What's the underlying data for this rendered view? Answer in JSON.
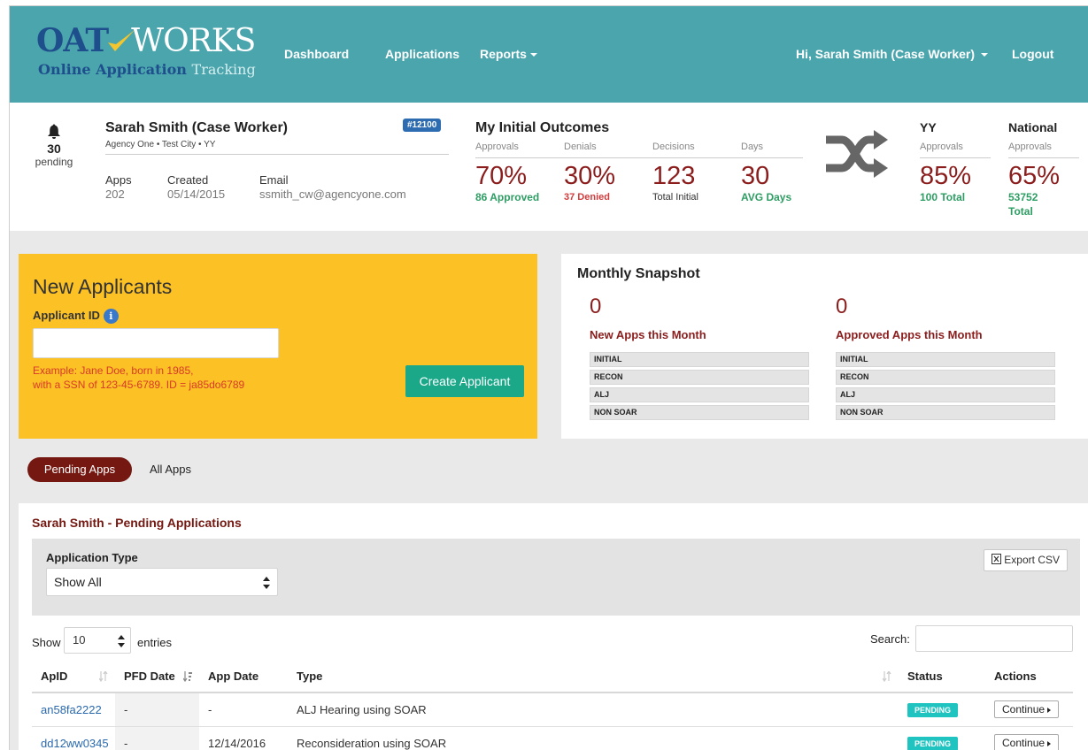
{
  "logo": {
    "oat": "OAT",
    "works": "WORKS",
    "tag_bold": "Online Application",
    "tag_light": "Tracking"
  },
  "nav": {
    "dashboard": "Dashboard",
    "applications": "Applications",
    "reports": "Reports",
    "user": "Hi, Sarah Smith (Case Worker)",
    "logout": "Logout"
  },
  "profile": {
    "pending_count": "30",
    "pending_label": "pending",
    "name": "Sarah Smith (Case Worker)",
    "agency": "Agency One • Test City • YY",
    "badge": "#12100",
    "apps_label": "Apps",
    "apps_value": "202",
    "created_label": "Created",
    "created_value": "05/14/2015",
    "email_label": "Email",
    "email_value": "ssmith_cw@agencyone.com"
  },
  "outcomes": {
    "title": "My Initial Outcomes",
    "approvals_hdr": "Approvals",
    "denials_hdr": "Denials",
    "decisions_hdr": "Decisions",
    "days_hdr": "Days",
    "approvals_pct": "70%",
    "approvals_sub": "86 Approved",
    "denials_pct": "30%",
    "denials_sub": "37 Denied",
    "decisions_val": "123",
    "decisions_sub": "Total Initial",
    "days_val": "30",
    "days_sub": "AVG Days",
    "yy_title": "YY",
    "yy_hdr": "Approvals",
    "yy_pct": "85%",
    "yy_sub": "100 Total",
    "nat_title": "National",
    "nat_hdr": "Approvals",
    "nat_pct": "65%",
    "nat_sub1": "53752",
    "nat_sub2": "Total"
  },
  "new_applicants": {
    "title": "New Applicants",
    "label": "Applicant ID",
    "info_glyph": "i",
    "input_value": "",
    "example1": "Example: Jane Doe, born in 1985,",
    "example2": "with a SSN of 123-45-6789. ID = ja85do6789",
    "button": "Create Applicant"
  },
  "monthly": {
    "title": "Monthly Snapshot",
    "new_count": "0",
    "new_label": "New Apps this Month",
    "approved_count": "0",
    "approved_label": "Approved Apps this Month",
    "categories": [
      "INITIAL",
      "RECON",
      "ALJ",
      "NON SOAR"
    ]
  },
  "tabs": {
    "pending": "Pending Apps",
    "all": "All Apps"
  },
  "table_section": {
    "title": "Sarah Smith - Pending Applications",
    "filter_label": "Application Type",
    "filter_value": "Show All",
    "export": "Export CSV",
    "show": "Show",
    "entries_value": "10",
    "entries": "entries",
    "search": "Search:",
    "columns": [
      "ApID",
      "PFD Date",
      "App Date",
      "Type",
      "Status",
      "Actions"
    ],
    "rows": [
      {
        "apid": "an58fa2222",
        "pfd": "-",
        "app_date": "-",
        "type": "ALJ Hearing using SOAR",
        "status": "PENDING",
        "action": "Continue"
      },
      {
        "apid": "dd12ww0345",
        "pfd": "-",
        "app_date": "12/14/2016",
        "type": "Reconsideration using SOAR",
        "status": "PENDING",
        "action": "Continue"
      }
    ]
  }
}
